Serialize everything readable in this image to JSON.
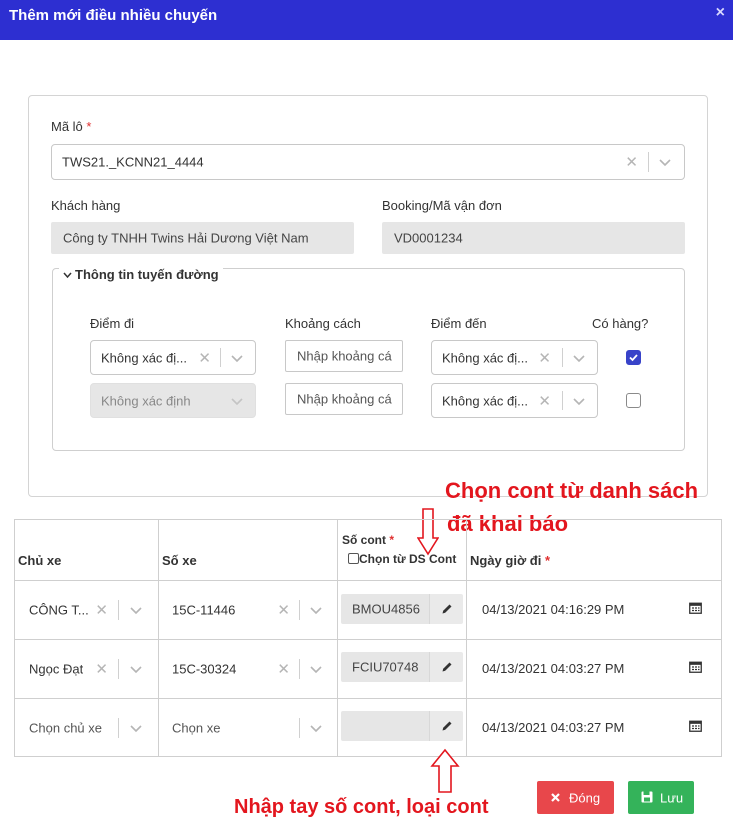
{
  "dialog": {
    "title": "Thêm mới điều nhiều chuyến",
    "close_glyph": "×"
  },
  "form": {
    "ma_lo_label": "Mã lô",
    "required_mark": "*",
    "ma_lo_value": "TWS21._KCNN21_4444",
    "khach_hang_label": "Khách hàng",
    "khach_hang_value": "Công ty TNHH Twins Hải Dương Việt Nam",
    "booking_label": "Booking/Mã vận đơn",
    "booking_value": "VD0001234"
  },
  "route": {
    "legend": "Thông tin tuyến đường",
    "col_from": "Điểm đi",
    "col_distance": "Khoảng cách",
    "col_to": "Điểm đến",
    "col_has_goods": "Có hàng?",
    "rows": [
      {
        "from": "Không xác đị...",
        "from_disabled": false,
        "distance_placeholder": "Nhập khoảng cá",
        "to": "Không xác đị...",
        "has_goods": true
      },
      {
        "from": "Không xác định",
        "from_disabled": true,
        "distance_placeholder": "Nhập khoảng cá",
        "to": "Không xác đị...",
        "has_goods": false
      }
    ]
  },
  "trips": {
    "headers": {
      "owner": "Chủ xe",
      "vehicle": "Số xe",
      "cont": "Số cont",
      "choose_from_list": "Chọn từ DS Cont",
      "departure": "Ngày giờ đi"
    },
    "rows": [
      {
        "owner": "CÔNG T...",
        "vehicle": "15C-11446",
        "cont": "BMOU4856",
        "departure": "04/13/2021 04:16:29 PM"
      },
      {
        "owner": "Ngọc Đạt",
        "vehicle": "15C-30324",
        "cont": "FCIU70748",
        "departure": "04/13/2021 04:03:27 PM"
      },
      {
        "owner": "Chọn chủ xe",
        "vehicle": "Chọn xe",
        "cont": "",
        "departure": "04/13/2021 04:03:27 PM"
      }
    ]
  },
  "annotations": {
    "top_line1": "Chọn cont từ danh sách",
    "top_line2": "đã khai báo",
    "bottom": "Nhập tay số cont, loại cont"
  },
  "buttons": {
    "close": "Đóng",
    "save": "Lưu"
  },
  "icons": [
    "close-icon",
    "clear-icon",
    "chevron-down-icon",
    "chevron-icon",
    "checkmark-icon",
    "pencil-icon",
    "calendar-icon",
    "arrow-down-icon",
    "arrow-up-icon",
    "x-icon",
    "save-icon"
  ],
  "colors": {
    "title_bar": "#2d2fd1",
    "annotation": "#e3161e",
    "close_button": "#e8474b",
    "save_button": "#34b35a",
    "checkbox_checked": "#3843c9",
    "readonly_bg": "#e6e6e6"
  }
}
